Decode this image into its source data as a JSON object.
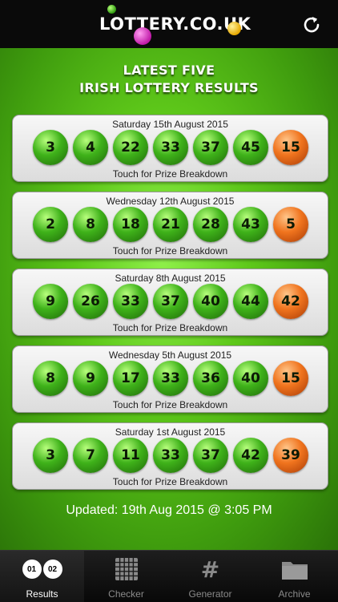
{
  "header": {
    "logo_text": "LOTTERY.CO.UK",
    "refresh_icon": "refresh-icon"
  },
  "title": {
    "line1": "LATEST FIVE",
    "line2": "IRISH LOTTERY RESULTS"
  },
  "draws": [
    {
      "date": "Saturday 15th August 2015",
      "numbers": [
        "3",
        "4",
        "22",
        "33",
        "37",
        "45"
      ],
      "bonus": "15",
      "link": "Touch for Prize Breakdown"
    },
    {
      "date": "Wednesday 12th August 2015",
      "numbers": [
        "2",
        "8",
        "18",
        "21",
        "28",
        "43"
      ],
      "bonus": "5",
      "link": "Touch for Prize Breakdown"
    },
    {
      "date": "Saturday 8th August 2015",
      "numbers": [
        "9",
        "26",
        "33",
        "37",
        "40",
        "44"
      ],
      "bonus": "42",
      "link": "Touch for Prize Breakdown"
    },
    {
      "date": "Wednesday 5th August 2015",
      "numbers": [
        "8",
        "9",
        "17",
        "33",
        "36",
        "40"
      ],
      "bonus": "15",
      "link": "Touch for Prize Breakdown"
    },
    {
      "date": "Saturday 1st August 2015",
      "numbers": [
        "3",
        "7",
        "11",
        "33",
        "37",
        "42"
      ],
      "bonus": "39",
      "link": "Touch for Prize Breakdown"
    }
  ],
  "updated": "Updated: 19th Aug 2015 @ 3:05 PM",
  "tabbar": {
    "tabs": [
      {
        "label": "Results",
        "icon": "results-icon",
        "pill1": "01",
        "pill2": "02",
        "active": true
      },
      {
        "label": "Checker",
        "icon": "grid-icon"
      },
      {
        "label": "Generator",
        "icon": "hash-icon",
        "symbol": "#"
      },
      {
        "label": "Archive",
        "icon": "folder-icon"
      }
    ]
  },
  "colors": {
    "main_ball": "#3fb21a",
    "bonus_ball": "#f0741e",
    "background_green": "#5ec81a"
  }
}
